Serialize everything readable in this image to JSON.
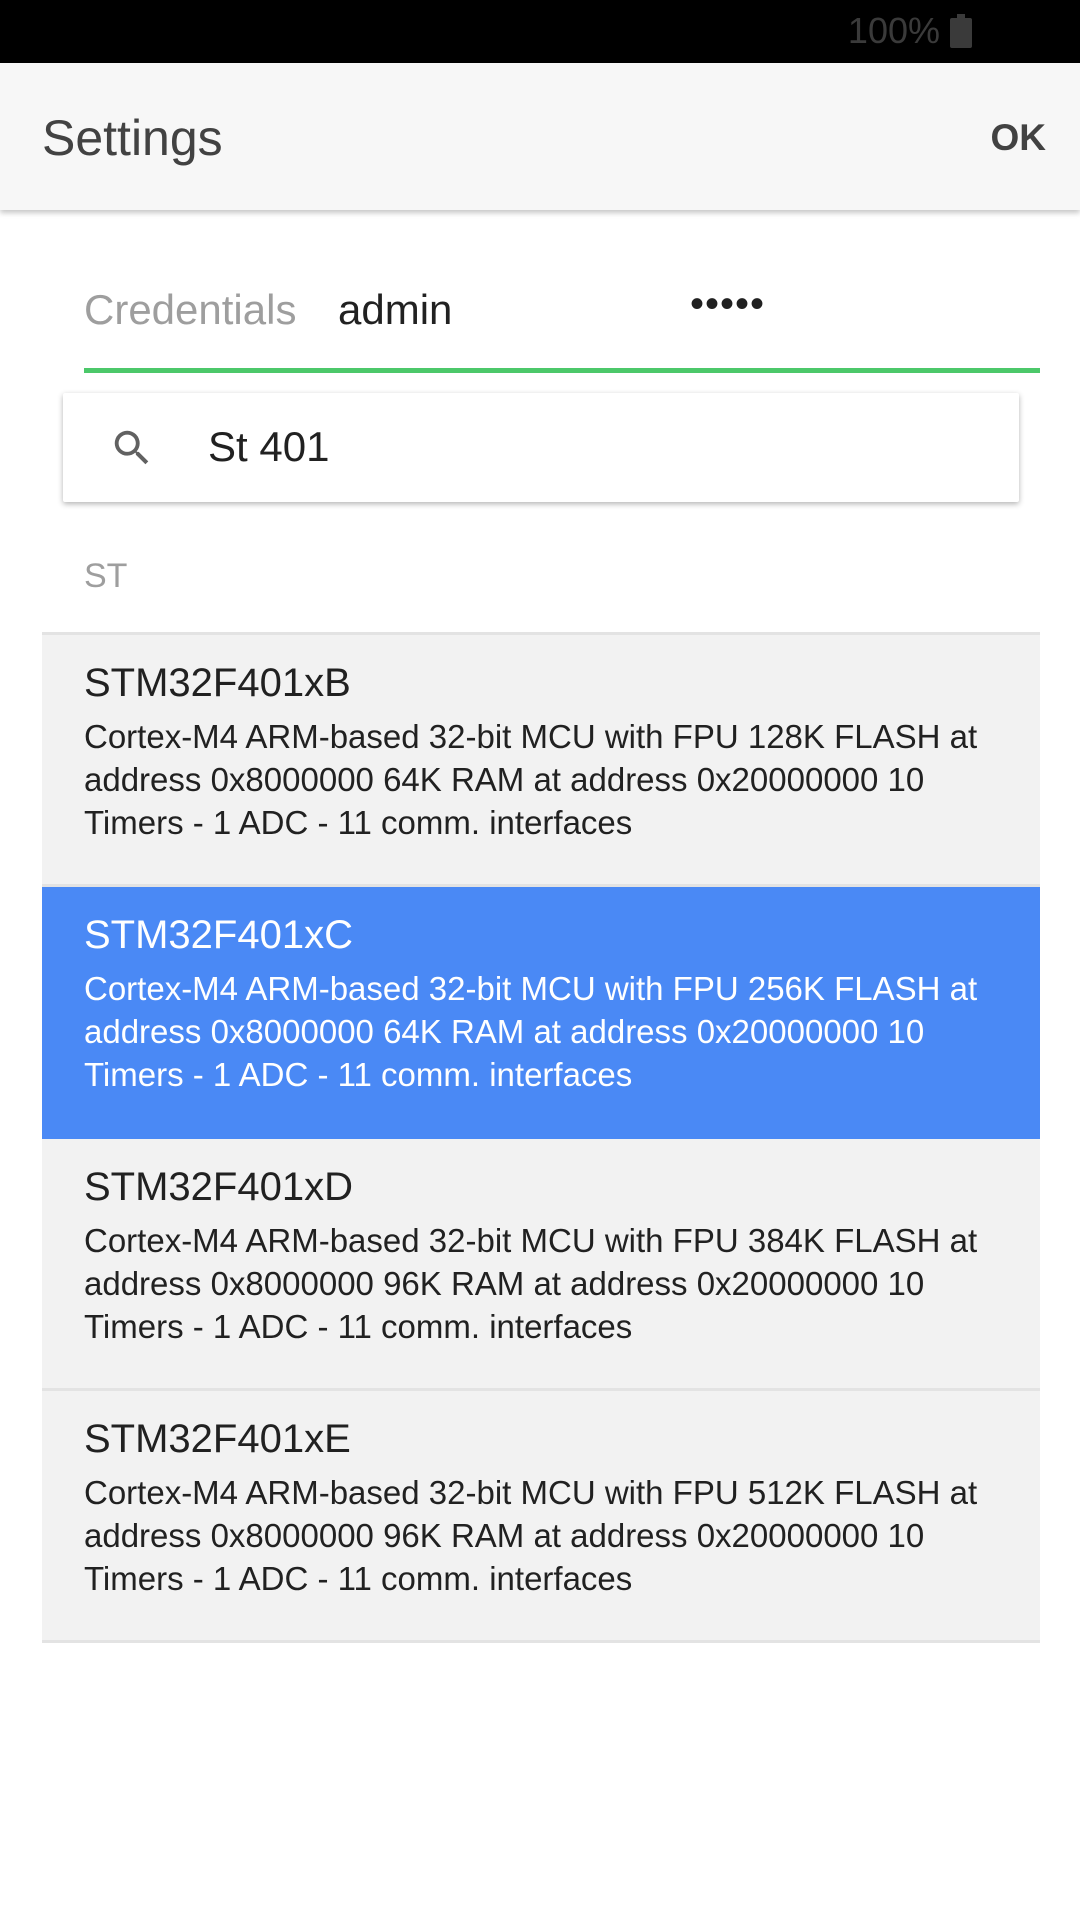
{
  "status_bar": {
    "battery_percent": "100%",
    "battery_icon": "battery-full-icon"
  },
  "app_bar": {
    "title": "Settings",
    "ok_label": "OK"
  },
  "credentials": {
    "label": "Credentials",
    "username": "admin",
    "password_masked": "•••••",
    "underline_color": "#4cc86a"
  },
  "search": {
    "icon": "search-icon",
    "value": "St 401",
    "placeholder": ""
  },
  "list": {
    "section_header": "ST",
    "selected_color": "#4a89f5",
    "items": [
      {
        "name": "STM32F401xB",
        "description": "Cortex-M4 ARM-based 32-bit MCU with FPU 128K FLASH at address 0x8000000 64K RAM at address 0x20000000 10 Timers - 1 ADC - 11 comm. interfaces",
        "selected": false
      },
      {
        "name": "STM32F401xC",
        "description": "Cortex-M4 ARM-based 32-bit MCU with FPU 256K FLASH at address 0x8000000 64K RAM at address 0x20000000 10 Timers - 1 ADC - 11 comm. interfaces",
        "selected": true
      },
      {
        "name": "STM32F401xD",
        "description": "Cortex-M4 ARM-based 32-bit MCU with FPU 384K FLASH at address 0x8000000 96K RAM at address 0x20000000 10 Timers - 1 ADC - 11 comm. interfaces",
        "selected": false
      },
      {
        "name": "STM32F401xE",
        "description": "Cortex-M4 ARM-based 32-bit MCU with FPU 512K FLASH at address 0x8000000 96K RAM at address 0x20000000 10 Timers - 1 ADC - 11 comm. interfaces",
        "selected": false
      }
    ]
  }
}
